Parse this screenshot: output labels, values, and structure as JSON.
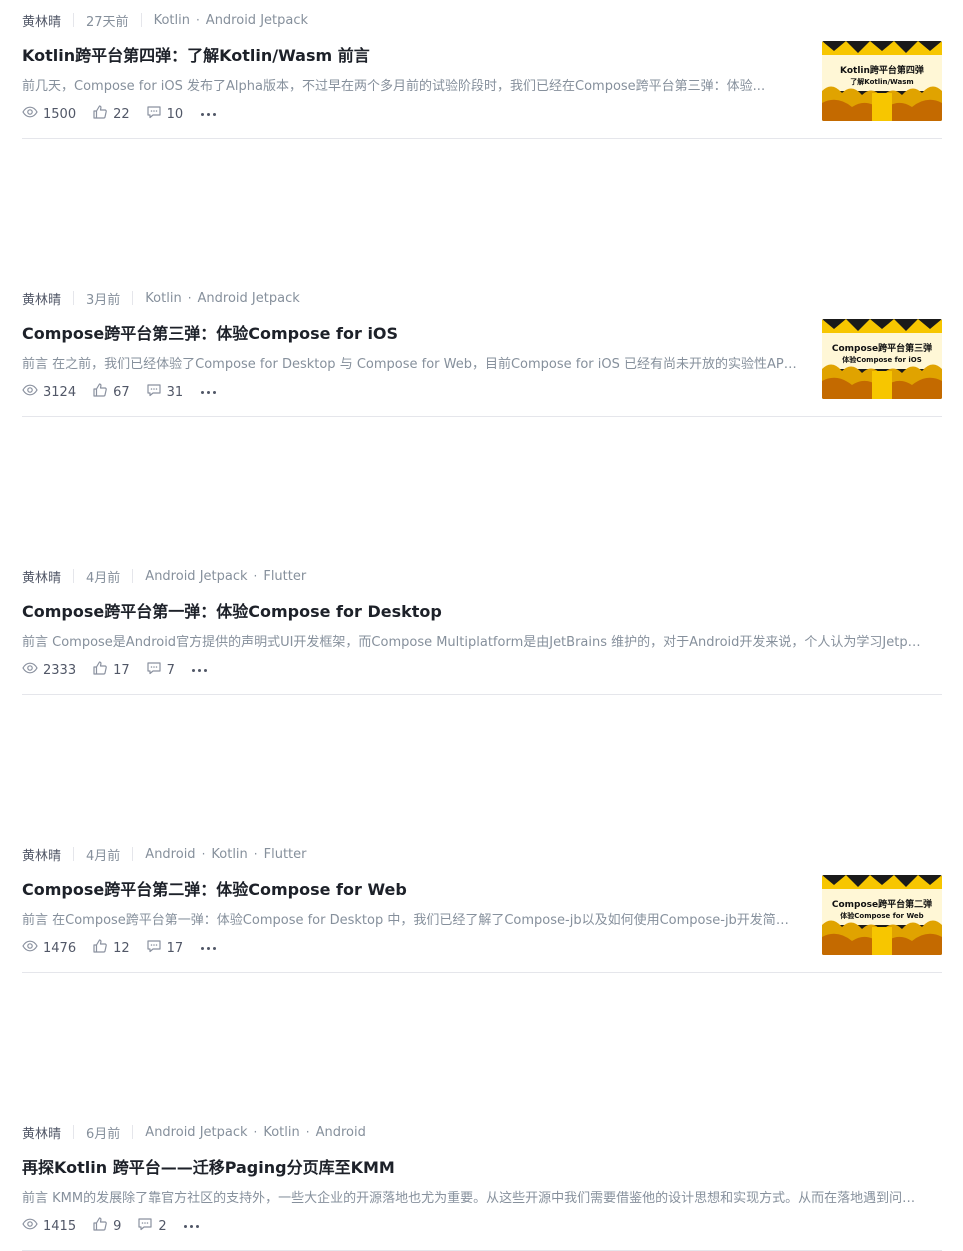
{
  "articles": [
    {
      "author": "黄林晴",
      "time": "27天前",
      "tags": [
        "Kotlin",
        "Android Jetpack"
      ],
      "title": "Kotlin跨平台第四弹：了解Kotlin/Wasm 前言",
      "abstract": "前几天，Compose for iOS 发布了Alpha版本，不过早在两个多月前的试验阶段时，我们已经在Compose跨平台第三弹：体验...",
      "views": "1500",
      "likes": "22",
      "comments": "10",
      "thumb": {
        "line1": "Kotlin跨平台第四弹",
        "line2": "了解Kotlin/Wasm"
      }
    },
    {
      "author": "黄林晴",
      "time": "3月前",
      "tags": [
        "Kotlin",
        "Android Jetpack"
      ],
      "title": "Compose跨平台第三弹：体验Compose for iOS",
      "abstract": "前言 在之前，我们已经体验了Compose for Desktop 与 Compose for Web，目前Compose for iOS 已经有尚未开放的实验性API，...",
      "views": "3124",
      "likes": "67",
      "comments": "31",
      "thumb": {
        "line1": "Compose跨平台第三弹",
        "line2": "体验Compose for iOS"
      }
    },
    {
      "author": "黄林晴",
      "time": "4月前",
      "tags": [
        "Android Jetpack",
        "Flutter"
      ],
      "title": "Compose跨平台第一弹：体验Compose for Desktop",
      "abstract": "前言 Compose是Android官方提供的声明式UI开发框架，而Compose Multiplatform是由JetBrains 维护的，对于Android开发来说，个人认为学习Jetpack C",
      "views": "2333",
      "likes": "17",
      "comments": "7"
    },
    {
      "author": "黄林晴",
      "time": "4月前",
      "tags": [
        "Android",
        "Kotlin",
        "Flutter"
      ],
      "title": "Compose跨平台第二弹：体验Compose for Web",
      "abstract": "前言 在Compose跨平台第一弹：体验Compose for Desktop 中，我们已经了解了Compose-jb以及如何使用Compose-jb开发简单的...",
      "views": "1476",
      "likes": "12",
      "comments": "17",
      "thumb": {
        "line1": "Compose跨平台第二弹",
        "line2": "体验Compose for Web"
      }
    },
    {
      "author": "黄林晴",
      "time": "6月前",
      "tags": [
        "Android Jetpack",
        "Kotlin",
        "Android"
      ],
      "title": "再探Kotlin 跨平台——迁移Paging分页库至KMM",
      "abstract": "前言 KMM的发展除了靠官方社区的支持外，一些大企业的开源落地也尤为重要。从这些开源中我们需要借鉴他的设计思想和实现方式。从而在落地遇到问题时...",
      "views": "1415",
      "likes": "9",
      "comments": "2"
    }
  ],
  "colors": {
    "accent": "#1e80ff",
    "title": "#1d2129",
    "muted": "#86909c",
    "thumbBg": "#f7c600"
  }
}
